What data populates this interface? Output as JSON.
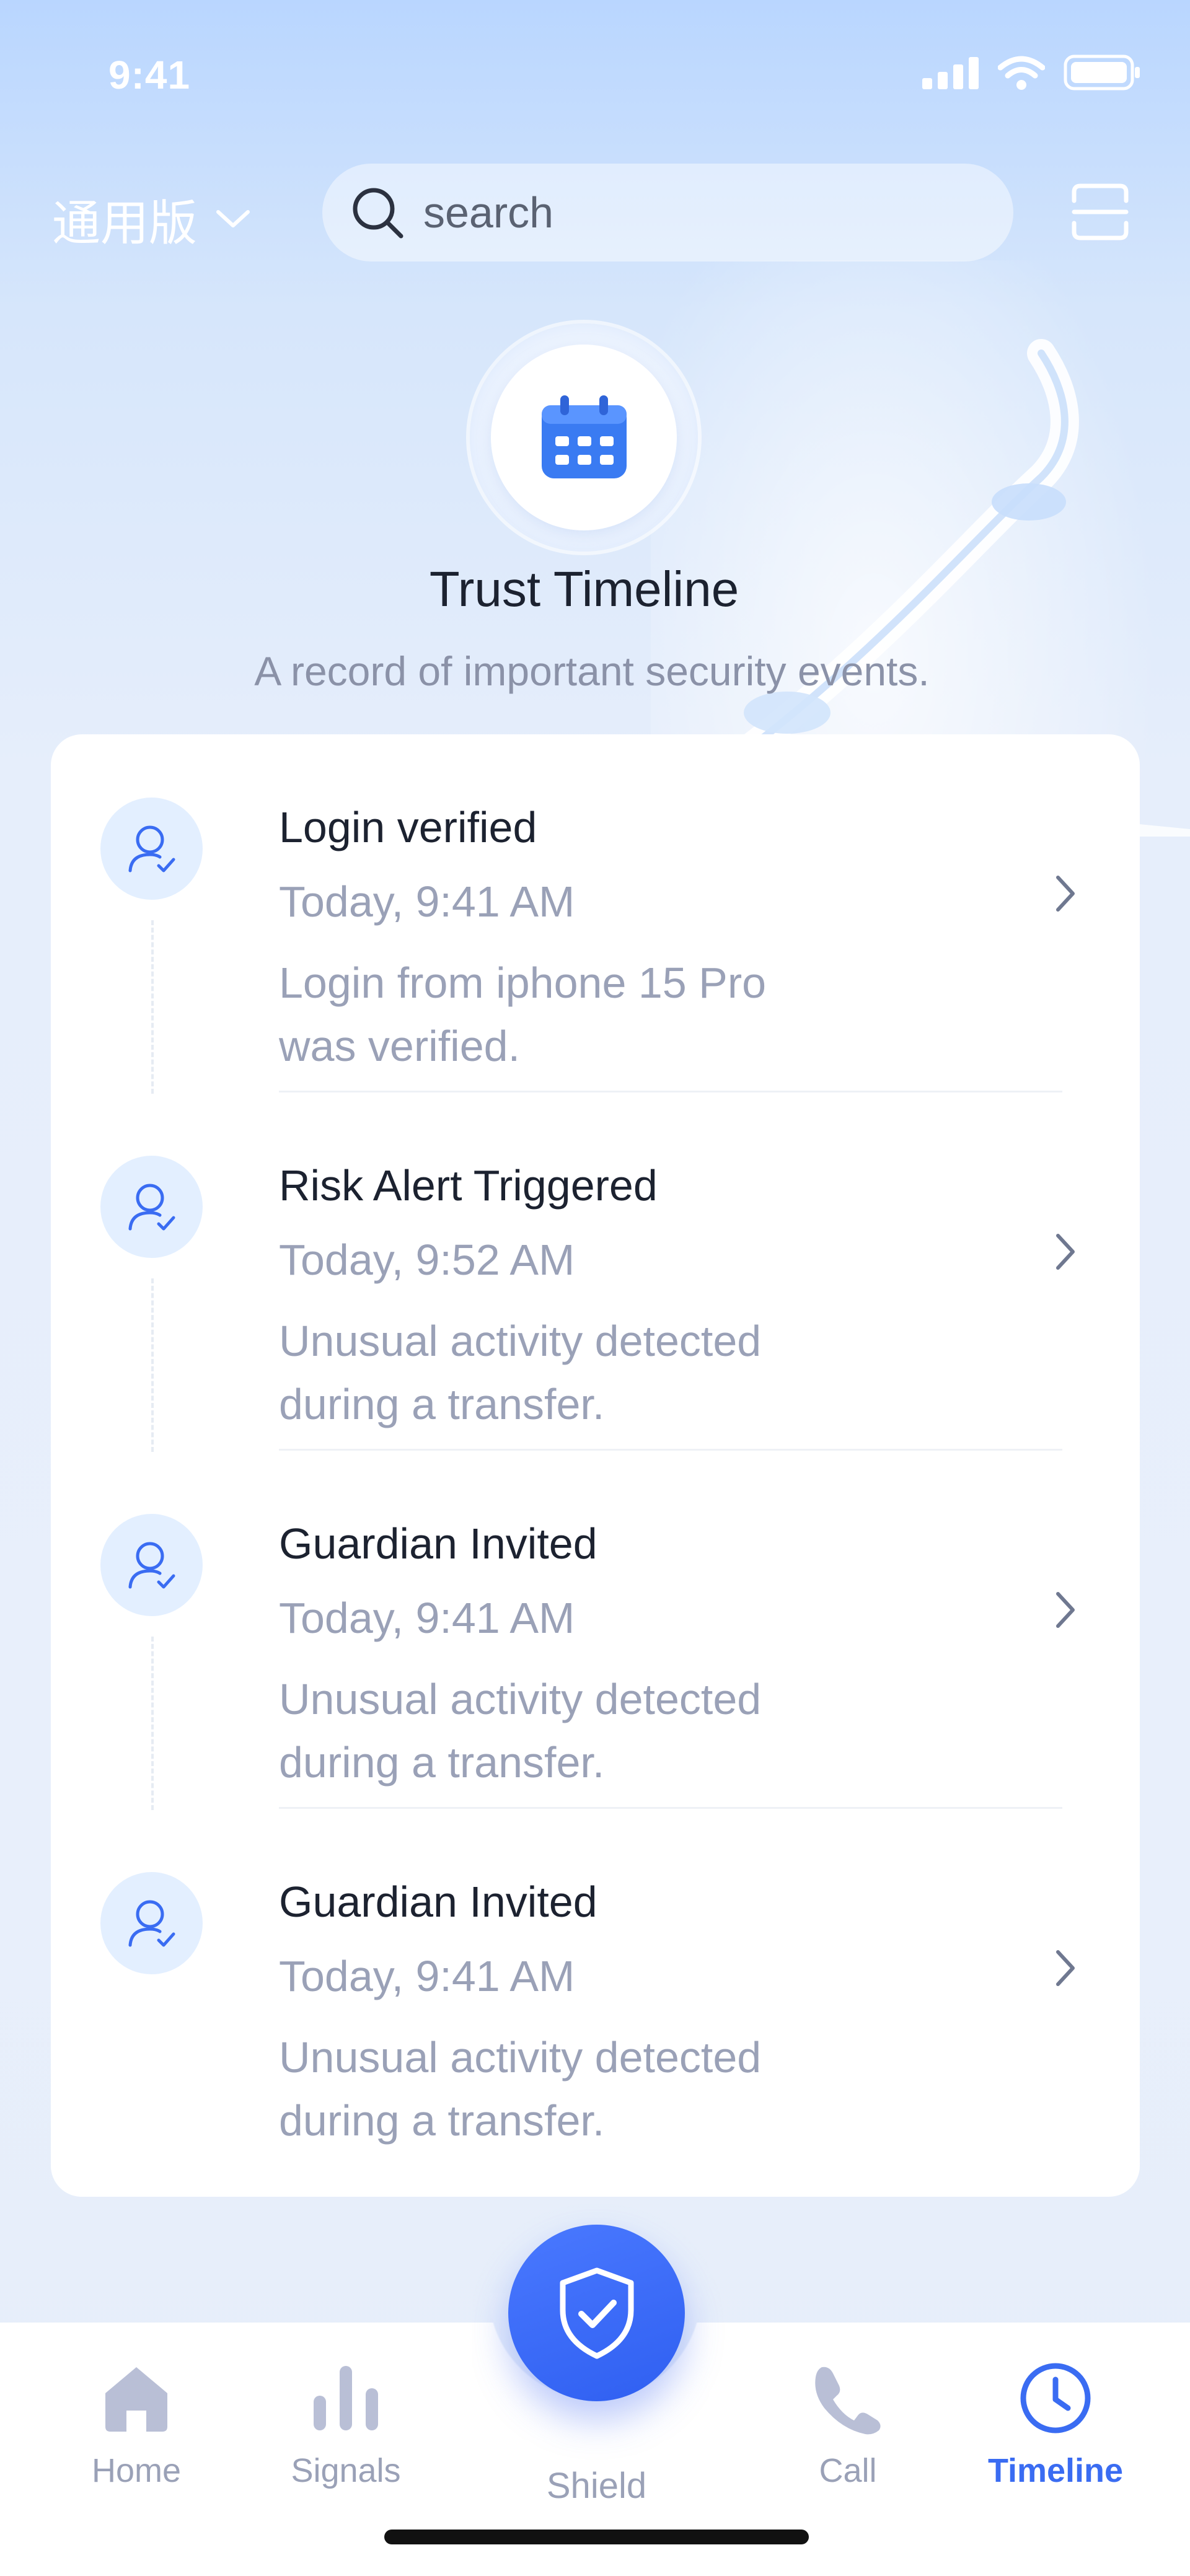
{
  "status_bar": {
    "time": "9:41"
  },
  "header": {
    "version_label": "通用版",
    "search_placeholder": "search"
  },
  "hero": {
    "title": "Trust Timeline",
    "subtitle": "A record of important security events."
  },
  "events": [
    {
      "title": "Login verified",
      "time": "Today, 9:41 AM",
      "desc_line1": "Login from iphone 15 Pro",
      "desc_line2": "was verified."
    },
    {
      "title": "Risk Alert Triggered",
      "time": "Today, 9:52 AM",
      "desc_line1": "Unusual activity detected",
      "desc_line2": "during a transfer."
    },
    {
      "title": "Guardian Invited",
      "time": "Today, 9:41 AM",
      "desc_line1": "Unusual activity detected",
      "desc_line2": "during a transfer."
    },
    {
      "title": "Guardian Invited",
      "time": "Today, 9:41 AM",
      "desc_line1": "Unusual activity detected",
      "desc_line2": "during a transfer."
    }
  ],
  "tabbar": {
    "home": "Home",
    "signals": "Signals",
    "shield": "Shield",
    "call": "Call",
    "timeline": "Timeline",
    "active": "timeline"
  },
  "colors": {
    "accent": "#3a6cf2",
    "text_primary": "#1c2230",
    "text_secondary": "#9aa1b7",
    "avatar_bg": "#e3efff"
  },
  "icons": {
    "search": "search-icon",
    "scan": "scan-icon",
    "calendar": "calendar-icon",
    "user_check": "user-check-icon",
    "chevron": "chevron-right-icon",
    "home": "home-icon",
    "signals": "signal-bars-icon",
    "shield": "shield-check-icon",
    "call": "phone-icon",
    "timeline": "clock-icon"
  }
}
